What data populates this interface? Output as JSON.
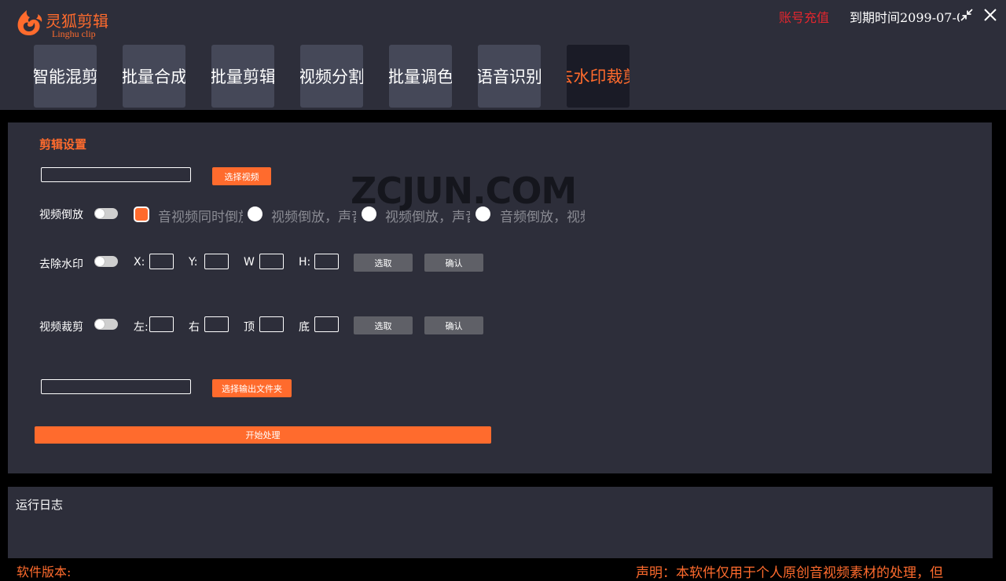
{
  "app": {
    "logo_cn": "灵狐剪辑",
    "logo_en": "Linghu clip",
    "recharge_label": "账号充值",
    "expiry_text": "到期时间2099-07-0"
  },
  "tabs": [
    {
      "label": "智能混剪",
      "active": false
    },
    {
      "label": "批量合成",
      "active": false
    },
    {
      "label": "批量剪辑",
      "active": false
    },
    {
      "label": "视频分割",
      "active": false
    },
    {
      "label": "批量调色",
      "active": false
    },
    {
      "label": "语音识别",
      "active": false
    },
    {
      "label": "去水印裁剪",
      "active": true
    }
  ],
  "settings": {
    "title": "剪辑设置",
    "video_input_value": "",
    "select_video_label": "选择视频",
    "reverse": {
      "label": "视频倒放",
      "options": [
        "音视频同时倒放",
        "视频倒放，声音正常",
        "视频倒放，声音去除",
        "音频倒放，视频正常"
      ]
    },
    "watermark": {
      "label": "去除水印",
      "x_label": "X:",
      "y_label": "Y:",
      "w_label": "W",
      "h_label": "H:",
      "pick_label": "选取",
      "confirm_label": "确认"
    },
    "crop": {
      "label": "视频裁剪",
      "left_label": "左:",
      "right_label": "右",
      "top_label": "顶",
      "bottom_label": "底",
      "pick_label": "选取",
      "confirm_label": "确认"
    },
    "output_input_value": "",
    "select_output_label": "选择输出文件夹",
    "start_label": "开始处理"
  },
  "overlay_watermark": "ZCJUN.COM",
  "log": {
    "title": "运行日志"
  },
  "footer": {
    "version_label": "软件版本:",
    "notice": "声明：本软件仅用于个人原创音视频素材的处理，但"
  },
  "colors": {
    "accent": "#ff6b2d",
    "recharge": "#e4262e",
    "panel_bg": "#2d2e3a",
    "tab_bg": "#454858",
    "tab_active_bg": "#1a1b26"
  }
}
